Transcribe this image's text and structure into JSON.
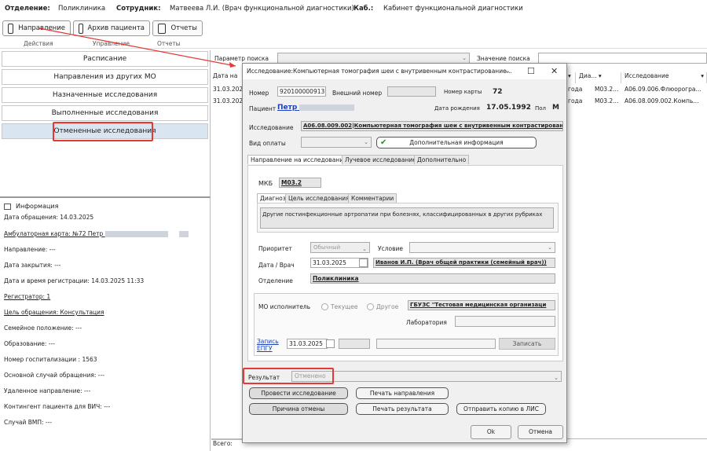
{
  "header": {
    "dept_label": "Отделение:",
    "dept_value": "Поликлиника",
    "emp_label": "Сотрудник:",
    "emp_value": "Матвеева Л.И. (Врач функциональной диагностики)",
    "room_label": "Каб.:",
    "room_value": "Кабинет функциональной диагностики"
  },
  "toolbar": {
    "direction": "Направление",
    "archive": "Архив пациента",
    "reports": "Отчеты",
    "grp_actions": "Действия",
    "grp_control": "Управление",
    "grp_reports": "Отчеты"
  },
  "nav": [
    "Расписание",
    "Направления из других МО",
    "Назначенные исследования",
    "Выполненные исследования",
    "Отмененные исследования"
  ],
  "info": {
    "title": "Информация",
    "rows": [
      "Дата обращения: 14.03.2025",
      "Амбулаторная карта: №72 Петр",
      "Направление: ---",
      "Дата закрытия: ---",
      "Дата и время регистрации: 14.03.2025 11:33",
      "Регистратор: 1",
      "Цель обращения: Консультация",
      "Семейное положение: ---",
      "Образование: ---",
      "Номер госпитализации : 1563",
      "Основной случай обращения: ---",
      "Удаленное направление: ---",
      "Контингент пациента для ВИЧ: ---",
      "Случай ВМП: ---"
    ]
  },
  "search": {
    "param_label": "Параметр поиска",
    "value_label": "Значение поиска"
  },
  "grid": {
    "headers": [
      "Дата на",
      "Диа...",
      "Исследование"
    ],
    "rows": [
      {
        "date": "31.03.202",
        "place": "года",
        "diag": "M03.2...",
        "study": "A06.09.006.Флюорогра..."
      },
      {
        "date": "31.03.202",
        "place": "года",
        "diag": "M03.2...",
        "study": "A06.08.009.002.Компь..."
      }
    ],
    "total": "Всего:"
  },
  "modal": {
    "title": "Исследование:Компьютерная томография шеи с внутривенным контрастирование...",
    "number_label": "Номер",
    "number": "920100000913",
    "ext_label": "Внешний номер",
    "card_label": "Номер карты",
    "card": "72",
    "patient_label": "Пациент",
    "patient": "Петр",
    "dob_label": "Дата рождения",
    "dob": "17.05.1992",
    "sex_label": "Пол",
    "sex": "М",
    "study_label": "Исследование",
    "study": "A06.08.009.002|Компьютерная томография шеи с внутривенным контрастирован",
    "payment_label": "Вид оплаты",
    "extra_info": "Дополнительная информация",
    "tabs": [
      "Направление на исследование",
      "Лучевое исследование",
      "Дополнительно"
    ],
    "mkb_label": "МКБ",
    "mkb": "M03.2",
    "subtabs": [
      "Диагноз",
      "Цель исследования",
      "Комментарии"
    ],
    "diagnosis": "Другие постинфекционные артропатии при болезнях, классифицированных в других рубриках",
    "priority_label": "Приоритет",
    "priority": "Обычный",
    "condition_label": "Условие",
    "date_label": "Дата / Врач",
    "date": "31.03.2025",
    "doctor": "Иванов И.П. (Врач общей практики (семейный врач))",
    "dept_label": "Отделение",
    "dept": "Поликлиника",
    "mo_label": "МО исполнитель",
    "mo_current": "Текущее",
    "mo_other": "Другое",
    "mo_value": "ГБУЗС \"Тестовая медицинская организаци",
    "lab_label": "Лаборатория",
    "egpu_label": "Запись ЕПГУ",
    "egpu_date": "31.03.2025",
    "record_btn": "Записать",
    "result_label": "Результат",
    "result": "Отменено",
    "btn_conduct": "Провести исследование",
    "btn_print_dir": "Печать направления",
    "btn_cancel_reason": "Причина отмены",
    "btn_print_result": "Печать результата",
    "btn_send_lis": "Отправить копию в ЛИС",
    "btn_ok": "Ok",
    "btn_cancel": "Отмена"
  },
  "colors": {
    "accent_red": "#e53935",
    "selected_nav": "#d9e6f2",
    "link_blue": "#1a3fbf"
  }
}
